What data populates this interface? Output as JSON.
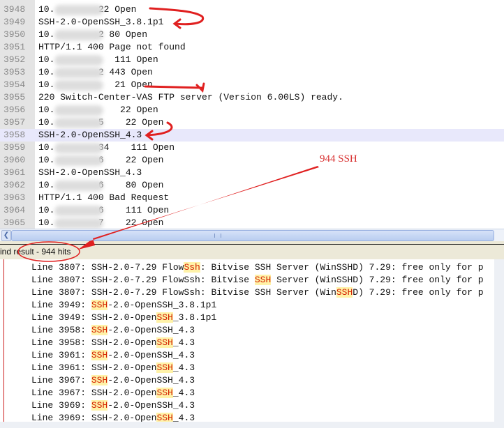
{
  "editor": {
    "lines": [
      {
        "num": "3948",
        "text": "10.        22 Open"
      },
      {
        "num": "3949",
        "text": "SSH-2.0-OpenSSH_3.8.1p1"
      },
      {
        "num": "3950",
        "text": "10.        2 80 Open"
      },
      {
        "num": "3951",
        "text": "HTTP/1.1 400 Page not found"
      },
      {
        "num": "3952",
        "text": "10.           111 Open"
      },
      {
        "num": "3953",
        "text": "10.        2 443 Open"
      },
      {
        "num": "3954",
        "text": "10.           21 Open"
      },
      {
        "num": "3955",
        "text": "220 Switch-Center-VAS FTP server (Version 6.00LS) ready."
      },
      {
        "num": "3956",
        "text": "10.            22 Open"
      },
      {
        "num": "3957",
        "text": "10.        5    22 Open"
      },
      {
        "num": "3958",
        "text": "SSH-2.0-OpenSSH_4.3"
      },
      {
        "num": "3959",
        "text": "10.        34    111 Open"
      },
      {
        "num": "3960",
        "text": "10.        6    22 Open"
      },
      {
        "num": "3961",
        "text": "SSH-2.0-OpenSSH_4.3"
      },
      {
        "num": "3962",
        "text": "10.        6    80 Open"
      },
      {
        "num": "3963",
        "text": "HTTP/1.1 400 Bad Request"
      },
      {
        "num": "3964",
        "text": "10.        6    111 Open"
      },
      {
        "num": "3965",
        "text": "10.        7    22 Open"
      }
    ],
    "current_line": "3958"
  },
  "find_result": {
    "label": "ind result - 944 hits"
  },
  "results": [
    {
      "pre": "Line 3807: SSH-2.0-7.29 Flow",
      "hit": "Ssh",
      "post": ": Bitvise SSH Server (WinSSHD) 7.29: free only for p"
    },
    {
      "pre": "Line 3807: SSH-2.0-7.29 FlowSsh: Bitvise ",
      "hit": "SSH",
      "post": " Server (WinSSHD) 7.29: free only for p"
    },
    {
      "pre": "Line 3807: SSH-2.0-7.29 FlowSsh: Bitvise SSH Server (Win",
      "hit": "SSH",
      "post": "D) 7.29: free only for p"
    },
    {
      "pre": "Line 3949: ",
      "hit": "SSH",
      "post": "-2.0-OpenSSH_3.8.1p1"
    },
    {
      "pre": "Line 3949: SSH-2.0-Open",
      "hit": "SSH",
      "post": "_3.8.1p1"
    },
    {
      "pre": "Line 3958: ",
      "hit": "SSH",
      "post": "-2.0-OpenSSH_4.3"
    },
    {
      "pre": "Line 3958: SSH-2.0-Open",
      "hit": "SSH",
      "post": "_4.3"
    },
    {
      "pre": "Line 3961: ",
      "hit": "SSH",
      "post": "-2.0-OpenSSH_4.3"
    },
    {
      "pre": "Line 3961: SSH-2.0-Open",
      "hit": "SSH",
      "post": "_4.3"
    },
    {
      "pre": "Line 3967: ",
      "hit": "SSH",
      "post": "-2.0-OpenSSH_4.3"
    },
    {
      "pre": "Line 3967: SSH-2.0-Open",
      "hit": "SSH",
      "post": "_4.3"
    },
    {
      "pre": "Line 3969: ",
      "hit": "SSH",
      "post": "-2.0-OpenSSH_4.3"
    },
    {
      "pre": "Line 3969: SSH-2.0-Open",
      "hit": "SSH",
      "post": "_4.3"
    }
  ],
  "annotation": {
    "note": "944 SSH",
    "color": "#e02020"
  }
}
